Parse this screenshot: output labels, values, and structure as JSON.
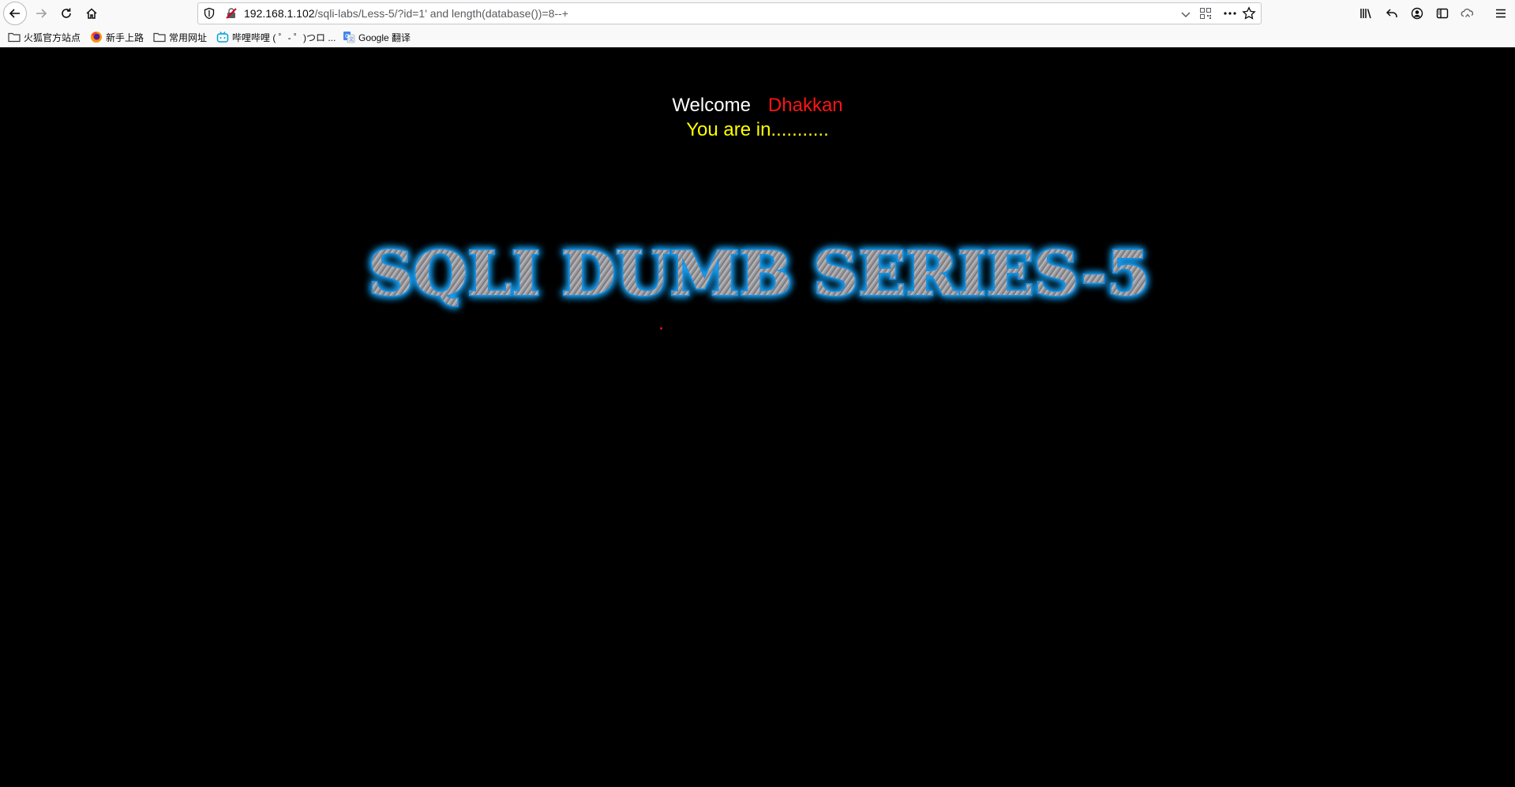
{
  "browser": {
    "url_host": "192.168.1.102",
    "url_path": "/sqli-labs/Less-5/?id=1' and length(database())=8--+",
    "icons": [
      "back-icon",
      "forward-icon",
      "reload-icon",
      "home-icon",
      "shield-icon",
      "not-secure-icon",
      "dropdown-icon",
      "qr-code-icon",
      "more-icon",
      "star-icon",
      "library-icon",
      "undo-icon",
      "account-icon",
      "sidebar-icon",
      "sync-icon",
      "menu-icon"
    ]
  },
  "bookmarks": [
    {
      "label": "火狐官方站点",
      "icon": "folder-icon"
    },
    {
      "label": "新手上路",
      "icon": "firefox-icon"
    },
    {
      "label": "常用网址",
      "icon": "folder-icon"
    },
    {
      "label": "哔哩哔哩 ( ゜- ゜)つロ ...",
      "icon": "bilibili-icon"
    },
    {
      "label": "Google 翻译",
      "icon": "google-translate-icon"
    }
  ],
  "page": {
    "welcome": "Welcome",
    "user": "Dhakkan",
    "status": "You are in...........",
    "banner_text": "SQLI DUMB SERIES-5"
  },
  "colors": {
    "background": "#000000",
    "welcome": "#ffffff",
    "user": "#ff1414",
    "status": "#ffff00",
    "banner_glow": "#1aa7ff"
  }
}
